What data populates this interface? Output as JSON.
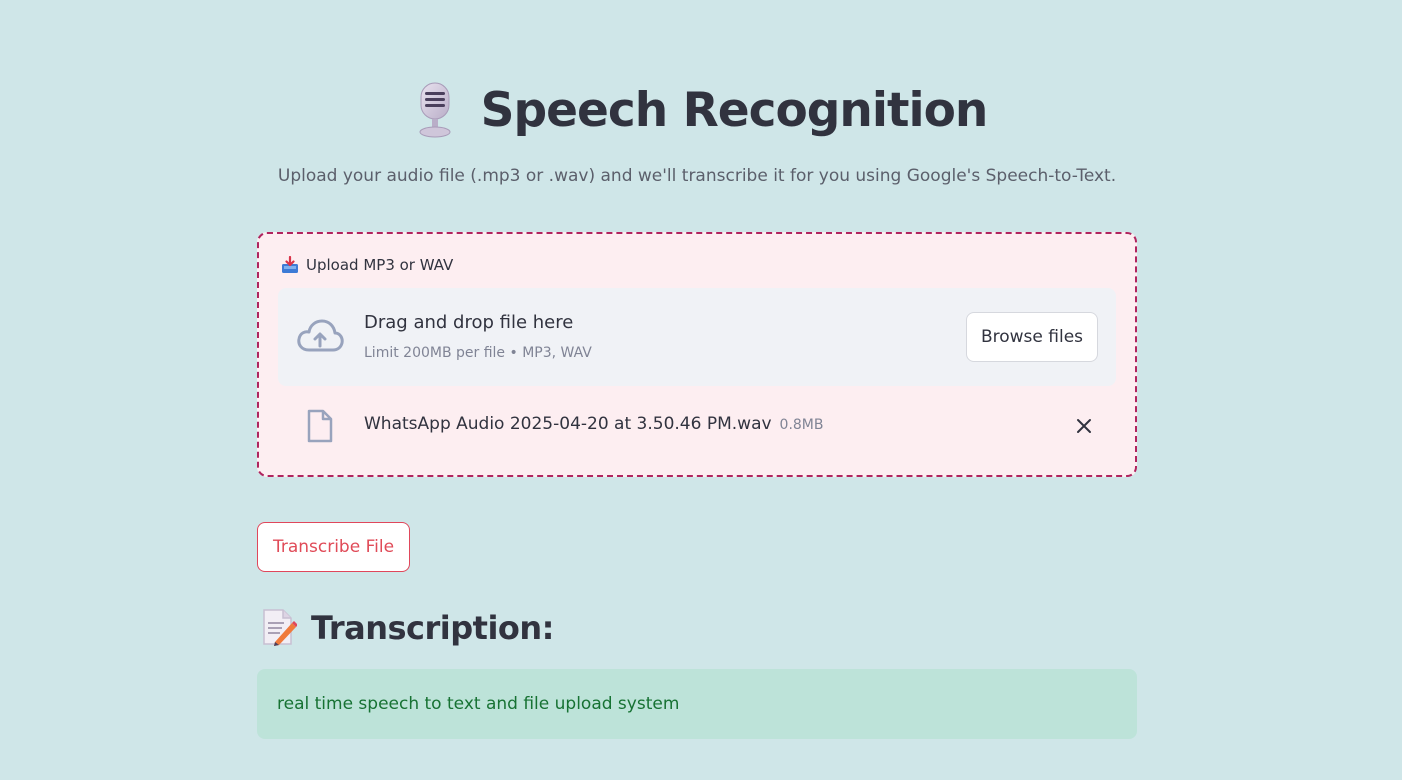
{
  "header": {
    "title": "Speech Recognition",
    "subtitle": "Upload your audio file (.mp3 or .wav) and we'll transcribe it for you using Google's Speech-to-Text.",
    "title_icon": "microphone-icon"
  },
  "uploader": {
    "label": "Upload MP3 or WAV",
    "label_icon": "inbox-tray-icon",
    "drop_title": "Drag and drop file here",
    "drop_limit": "Limit 200MB per file • MP3, WAV",
    "browse_label": "Browse files",
    "cloud_icon": "cloud-upload-icon",
    "uploaded_file": {
      "name": "WhatsApp Audio 2025-04-20 at 3.50.46 PM.wav",
      "size": "0.8MB",
      "file_icon": "file-icon",
      "remove_icon": "close-icon"
    }
  },
  "actions": {
    "transcribe_label": "Transcribe File"
  },
  "transcription": {
    "heading": "Transcription:",
    "heading_icon": "memo-icon",
    "text": "real time speech to text and file upload system"
  },
  "colors": {
    "background": "#cfe6e8",
    "upload_border": "#b0245e",
    "upload_bg": "#fdeef1",
    "accent_red": "#e04b58",
    "success_bg": "#bde3d9",
    "success_text": "#177233"
  }
}
